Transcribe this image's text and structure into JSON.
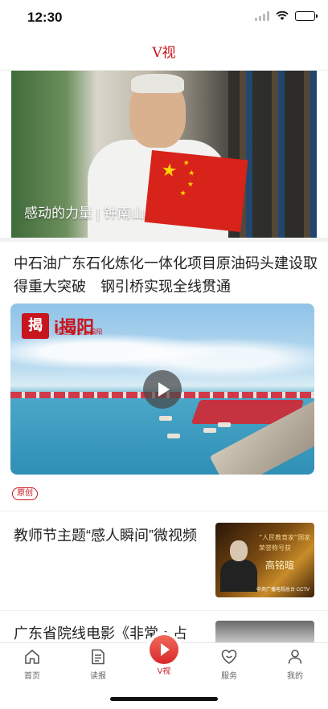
{
  "status_bar": {
    "time": "12:30"
  },
  "nav": {
    "title": "V视"
  },
  "hero": {
    "caption": "感动的力量 | 钟南山"
  },
  "article1": {
    "title": "中石油广东石化炼化一体化项目原油码头建设取得重大突破　钢引桥实现全线贯通",
    "video_logo_char": "揭",
    "video_logo_text": "i揭阳",
    "video_logo_sub": "在这里 爱上揭阳",
    "tag": "原创"
  },
  "article2": {
    "title": "教师节主题“感人瞬间”微视频",
    "thumb_quote": "“人民教育家”国家荣誉称号获",
    "thumb_name": "高铭暄",
    "thumb_source": "中央广播电视总台 CCTV"
  },
  "article3": {
    "title": "广东省院线电影《非常・占"
  },
  "tabbar": {
    "items": [
      {
        "label": "首页",
        "icon": "home-icon"
      },
      {
        "label": "读报",
        "icon": "newspaper-icon"
      },
      {
        "label": "V视",
        "icon": "play-icon"
      },
      {
        "label": "服务",
        "icon": "heart-smile-icon"
      },
      {
        "label": "我的",
        "icon": "person-icon"
      }
    ]
  },
  "colors": {
    "accent": "#c8161e",
    "text": "#222222",
    "muted": "#666666"
  }
}
